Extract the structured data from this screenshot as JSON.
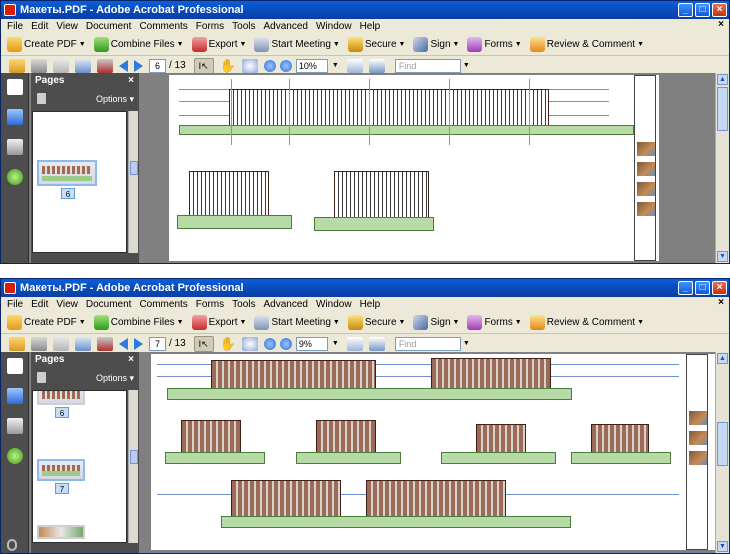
{
  "app": {
    "title": "Макеты.PDF - Adobe Acrobat Professional"
  },
  "menu": [
    "File",
    "Edit",
    "View",
    "Document",
    "Comments",
    "Forms",
    "Tools",
    "Advanced",
    "Window",
    "Help"
  ],
  "toolbar": {
    "create_pdf": "Create PDF",
    "combine_files": "Combine Files",
    "export": "Export",
    "start_meeting": "Start Meeting",
    "secure": "Secure",
    "sign": "Sign",
    "forms": "Forms",
    "review_comment": "Review & Comment"
  },
  "nav": {
    "find_placeholder": "Find",
    "total_pages": "/ 13"
  },
  "pages_panel": {
    "title": "Pages",
    "options": "Options"
  },
  "windows": [
    {
      "current_page": "6",
      "zoom": "10%",
      "thumb_labels": [
        "6"
      ]
    },
    {
      "current_page": "7",
      "zoom": "9%",
      "thumb_labels": [
        "6",
        "7"
      ]
    }
  ],
  "colors": {
    "title_bar": "#0a5fd8",
    "panel": "#4d4d4d",
    "workspace": "#808080",
    "selected_thumb": "#8fb8f0"
  },
  "icons": {
    "attach": "paperclip-icon",
    "pages": "pages-icon",
    "bookmarks": "bookmarks-icon",
    "signatures": "signatures-icon",
    "help": "help-icon"
  }
}
